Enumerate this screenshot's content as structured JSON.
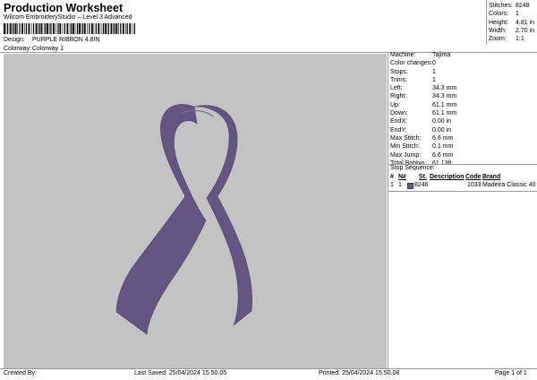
{
  "header": {
    "title": "Production Worksheet",
    "subtitle": "Wilcom EmbroideryStudio – Level 3 Advanced"
  },
  "design_info": [
    {
      "label": "Design:",
      "value": "PURPLE RIBBON 4.8IN"
    },
    {
      "label": "Colorway:",
      "value": "Colorway 1"
    }
  ],
  "top_stats": [
    {
      "label": "Stitches:",
      "value": "8248"
    },
    {
      "label": "Colors:",
      "value": "1"
    },
    {
      "label": "Height:",
      "value": "4.81 in"
    },
    {
      "label": "Width:",
      "value": "2.70 in"
    },
    {
      "label": "Zoom:",
      "value": "1:1"
    }
  ],
  "properties": [
    {
      "label": "Machine:",
      "value": "Tajima"
    },
    {
      "label": "Color changes:",
      "value": "0"
    },
    {
      "label": "Stops:",
      "value": "1"
    },
    {
      "label": "Trims:",
      "value": "1"
    },
    {
      "label": "Left:",
      "value": "34.3 mm"
    },
    {
      "label": "Right:",
      "value": "34.3 mm"
    },
    {
      "label": "Up:",
      "value": "61.1 mm"
    },
    {
      "label": "Down:",
      "value": "61.1 mm"
    },
    {
      "label": "EndX:",
      "value": "0.00 in"
    },
    {
      "label": "EndY:",
      "value": "0.00 in"
    },
    {
      "label": "Max Stitch:",
      "value": "6.6 mm"
    },
    {
      "label": "Min Stitch:",
      "value": "0.1 mm"
    },
    {
      "label": "Max Jump:",
      "value": "6.6 mm"
    },
    {
      "label": "Total Bobbin:",
      "value": "61.13ft"
    }
  ],
  "stop_sequence": {
    "title": "Stop Sequence:",
    "headers": {
      "num": "#",
      "n": "N#",
      "st": "St.",
      "description": "Description",
      "code": "Code",
      "brand": "Brand"
    },
    "rows": [
      {
        "num": "1",
        "n": "1",
        "st": "8246",
        "description": "",
        "code": "1033",
        "brand": "Madeira Classic 40",
        "color": "#6a5a88"
      }
    ]
  },
  "footer": {
    "created_by": "Created By:",
    "last_saved": "Last Saved: 25/04/2024 15.50.05",
    "printed": "Printed: 25/04/2024 15.50.08",
    "page": "Page 1 of 1"
  },
  "colors": {
    "canvas_bg": "#c3c3c3",
    "ribbon": "#6a5a88"
  }
}
